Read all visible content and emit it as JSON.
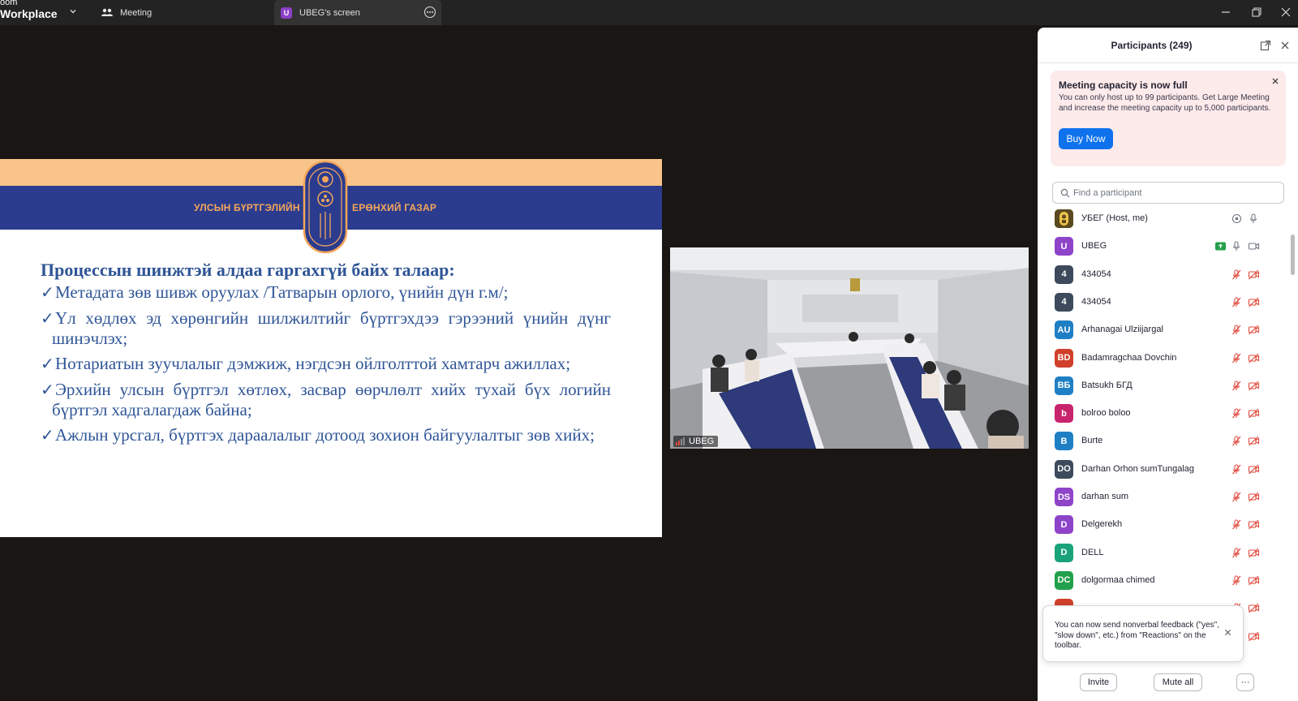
{
  "app": {
    "brand_line1": "oom",
    "brand_line2": "Workplace"
  },
  "tabs": {
    "meeting": "Meeting",
    "screen": "UBEG's screen",
    "screen_initial": "U"
  },
  "slide": {
    "org_left": "УЛСЫН БҮРТГЭЛИЙН",
    "org_right": "ЕРӨНХИЙ ГАЗАР",
    "title": "Процессын шинжтэй алдаа гаргахгүй байх талаар:",
    "check_mark": "✓",
    "bullets": [
      "Метадата зөв шивж оруулах /Татварын орлого, үнийн дүн г.м/;",
      "Үл хөдлөх эд хөрөнгийн шилжилтийг бүртгэхдээ гэрээний үнийн дүнг шинэчлэх;",
      "Нотариатын зуучлалыг дэмжиж, нэгдсэн ойлголттой хамтарч ажиллах;",
      "Эрхийн улсын бүртгэл хөтлөх, засвар өөрчлөлт хийх тухай бүх логийн бүртгэл хадгалагдаж байна;",
      "Ажлын урсгал, бүртгэх дараалалыг дотоод зохион байгуулалтыг зөв хийх;"
    ]
  },
  "video": {
    "label": "UBEG"
  },
  "panel": {
    "title": "Participants (249)",
    "alert_title": "Meeting capacity is now full",
    "alert_body": "You can only host up to 99 participants. Get Large Meeting and increase the meeting capacity up to 5,000 participants.",
    "buy_label": "Buy Now",
    "search_placeholder": "Find a participant",
    "toast_text": "You can now send nonverbal feedback (\"yes\", \"slow down\", etc.) from \"Reactions\" on the toolbar.",
    "invite_label": "Invite",
    "mute_all_label": "Mute all",
    "more_label": "···"
  },
  "participants": [
    {
      "initials": "",
      "name": "УБЕГ (Host, me)",
      "color": "#5a4a1e",
      "status": "host"
    },
    {
      "initials": "U",
      "name": "UBEG",
      "color": "#8e44c9",
      "status": "live"
    },
    {
      "initials": "4",
      "name": "434054",
      "color": "#3c4a5c",
      "status": "muted"
    },
    {
      "initials": "4",
      "name": "434054",
      "color": "#3c4a5c",
      "status": "muted"
    },
    {
      "initials": "AU",
      "name": "Arhanagai Ulziijargal",
      "color": "#1f7fc4",
      "status": "muted"
    },
    {
      "initials": "BD",
      "name": "Badamragchaa Dovchin",
      "color": "#d0402a",
      "status": "muted"
    },
    {
      "initials": "BБ",
      "name": "Batsukh БГД",
      "color": "#1f7fc4",
      "status": "muted"
    },
    {
      "initials": "b",
      "name": "bolroo boloo",
      "color": "#c8246e",
      "status": "muted"
    },
    {
      "initials": "B",
      "name": "Burte",
      "color": "#1f7fc4",
      "status": "muted"
    },
    {
      "initials": "DO",
      "name": "Darhan Orhon sumTungalag",
      "color": "#3c4a5c",
      "status": "muted"
    },
    {
      "initials": "DS",
      "name": "darhan sum",
      "color": "#8e44c9",
      "status": "muted"
    },
    {
      "initials": "D",
      "name": "Delgerekh",
      "color": "#8e44c9",
      "status": "muted"
    },
    {
      "initials": "D",
      "name": "DELL",
      "color": "#1aa37a",
      "status": "muted"
    },
    {
      "initials": "DC",
      "name": "dolgormaa chimed",
      "color": "#22a04b",
      "status": "muted"
    },
    {
      "initials": "",
      "name": "",
      "color": "#d0402a",
      "status": "muted"
    },
    {
      "initials": "",
      "name": "",
      "color": "#d0402a",
      "status": "muted"
    }
  ]
}
